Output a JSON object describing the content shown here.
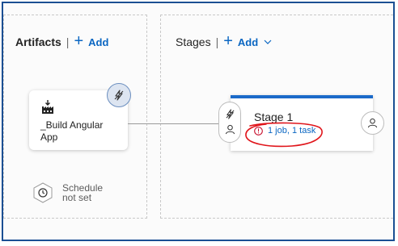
{
  "artifacts": {
    "title": "Artifacts",
    "separator": "|",
    "add_label": "Add",
    "card": {
      "name": "_Build Angular App",
      "icon": "build-pipeline-icon"
    },
    "trigger_icon": "lightning-icon",
    "schedule": {
      "icon": "clock-icon",
      "text": "Schedule not set"
    }
  },
  "stages": {
    "title": "Stages",
    "separator": "|",
    "add_label": "Add",
    "stage": {
      "name": "Stage 1",
      "jobs": "1 job, 1 task",
      "warning_icon": "warning-circle-icon",
      "annotation_color": "#e0141a"
    },
    "pre_conditions_icons": [
      "lightning-icon",
      "person-icon"
    ],
    "post_conditions_icon": "person-icon"
  },
  "colors": {
    "accent": "#0a66c2",
    "stage_bar": "#1b6ac9",
    "warning": "#c8102e",
    "frame": "#1b4f93"
  }
}
